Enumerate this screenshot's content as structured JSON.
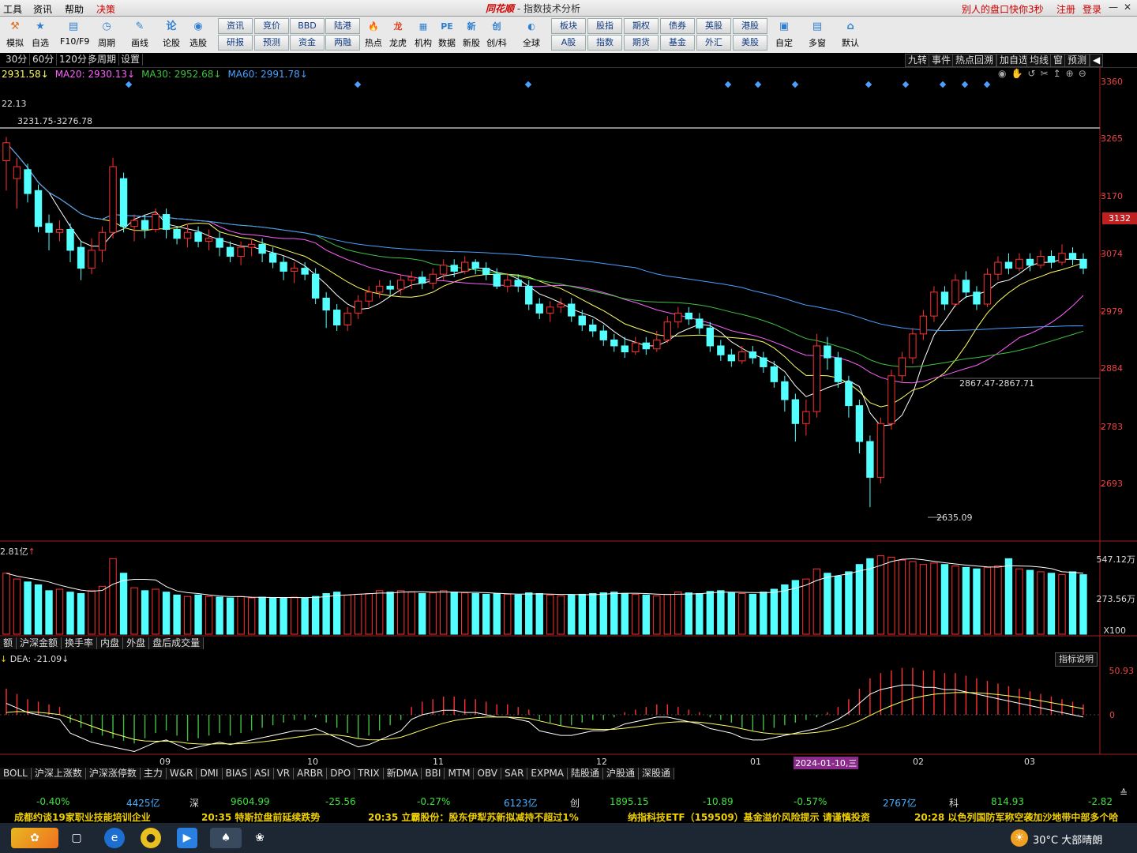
{
  "menubar": {
    "items": [
      "工具",
      "资讯",
      "帮助",
      "决策"
    ],
    "brand": "同花顺",
    "title": "指数技术分析",
    "promo": "别人的盘口快你3秒",
    "register": "注册",
    "login": "登录"
  },
  "toolbar": {
    "big_buttons": [
      {
        "label": "模拟",
        "icon": "simulate-icon"
      },
      {
        "label": "自选",
        "icon": "watchlist-icon"
      },
      {
        "label": "F10/F9",
        "icon": "f10-icon"
      },
      {
        "label": "周期",
        "icon": "period-icon"
      },
      {
        "label": "画线",
        "icon": "draw-line-icon"
      },
      {
        "label": "论股",
        "icon": "discuss-icon"
      },
      {
        "label": "选股",
        "icon": "stock-picker-icon"
      }
    ],
    "small_buttons_top": [
      "资讯",
      "竞价",
      "BBD",
      "陆港"
    ],
    "small_buttons_bottom": [
      "研报",
      "预测",
      "资金",
      "两融"
    ],
    "mid_buttons": [
      {
        "label": "热点",
        "icon": "hot-icon"
      },
      {
        "label": "龙虎",
        "icon": "dragon-tiger-icon"
      },
      {
        "label": "机构",
        "icon": "institution-icon"
      },
      {
        "label": "数据",
        "icon": "data-icon"
      },
      {
        "label": "新股",
        "icon": "ipo-icon"
      },
      {
        "label": "创/科",
        "icon": "chinext-icon"
      },
      {
        "label": "全球",
        "icon": "globe-icon"
      }
    ],
    "small_buttons2_top": [
      "板块",
      "股指",
      "期权",
      "债券",
      "英股",
      "港股"
    ],
    "small_buttons2_bottom": [
      "A股",
      "指数",
      "期货",
      "基金",
      "外汇",
      "美股"
    ],
    "right_buttons": [
      {
        "label": "自定",
        "icon": "custom-icon"
      },
      {
        "label": "多窗",
        "icon": "multi-window-icon"
      },
      {
        "label": "默认",
        "icon": "home-icon"
      }
    ]
  },
  "periods": [
    "30分",
    "60分",
    "120分",
    "多周期",
    "设置"
  ],
  "right_tabs": [
    "九转",
    "事件",
    "热点回溯",
    "加自选",
    "均线",
    "窗",
    "预测"
  ],
  "legend": {
    "close": "2931.58↓",
    "ma20": "MA20: 2930.13↓",
    "ma30": "MA30: 2952.68↓",
    "ma60": "MA60: 2991.78↓"
  },
  "colors": {
    "up": "#ff3030",
    "down": "#54ffff",
    "ma5": "#ffffff",
    "ma10": "#ffff60",
    "ma20": "#ff60ff",
    "ma30": "#40c040",
    "ma60": "#4aa0ff"
  },
  "price_axis": [
    "3360",
    "3265",
    "3170",
    "3074",
    "2979",
    "2884",
    "2783",
    "2693"
  ],
  "current_price_tag": "3132",
  "annotations": {
    "high_left": "22.13",
    "range_top": "3231.75-3276.78",
    "range_mid": "2867.47-2867.71",
    "low": "2635.09"
  },
  "volume": {
    "title": "2.81亿",
    "axis": [
      "547.12万",
      "273.56万",
      "X100"
    ]
  },
  "sub_tabs": [
    "额",
    "沪深金额",
    "换手率",
    "内盘",
    "外盘",
    "盘后成交量"
  ],
  "macd": {
    "title": "DEA: -21.09↓",
    "button": "指标说明",
    "axis": [
      "50.93",
      "0"
    ]
  },
  "x_axis": [
    "09",
    "10",
    "11",
    "12",
    "01",
    "2024-01-10,三",
    "02",
    "03"
  ],
  "indicator_tabs": [
    "BOLL",
    "沪深上涨数",
    "沪深涨停数",
    "主力",
    "W&R",
    "DMI",
    "BIAS",
    "ASI",
    "VR",
    "ARBR",
    "DPO",
    "TRIX",
    "新DMA",
    "BBI",
    "MTM",
    "OBV",
    "SAR",
    "EXPMA",
    "陆股通",
    "沪股通",
    "深股通"
  ],
  "status": {
    "sh_pct": "-0.40%",
    "sh_amt": "4425亿",
    "sz_label": "深",
    "sz_val": "9604.99",
    "sz_chg": "-25.56",
    "sz_pct": "-0.27%",
    "sz_amt": "6123亿",
    "cy_label": "创",
    "cy_val": "1895.15",
    "cy_chg": "-10.89",
    "cy_pct": "-0.57%",
    "cy_amt": "2767亿",
    "kc_label": "科",
    "kc_val": "814.93",
    "kc_chg": "-2.82"
  },
  "ticker": [
    "成都约谈19家职业技能培训企业",
    "20:35 特斯拉盘前延续跌势",
    "20:35 立霸股份：股东伊犁苏新拟减持不超过1%",
    "纳指科技ETF（159509）基金溢价风险提示 请谨慎投资",
    "20:28 以色列国防军称空袭加沙地带中部多个哈"
  ],
  "taskbar": {
    "weather": "30°C 大部晴朗"
  },
  "chart_data": {
    "type": "candlestick",
    "title": "",
    "ylim": [
      2600,
      3380
    ],
    "x_labels": [
      "09",
      "10",
      "11",
      "12",
      "01",
      "2024-01-10",
      "02",
      "03"
    ],
    "candles": [
      [
        3230,
        3260,
        3180,
        3270
      ],
      [
        3200,
        3220,
        3150,
        3235
      ],
      [
        3215,
        3175,
        3160,
        3225
      ],
      [
        3180,
        3120,
        3110,
        3190
      ],
      [
        3125,
        3110,
        3080,
        3140
      ],
      [
        3110,
        3115,
        3095,
        3130
      ],
      [
        3115,
        3080,
        3060,
        3125
      ],
      [
        3085,
        3050,
        3030,
        3095
      ],
      [
        3050,
        3080,
        3040,
        3100
      ],
      [
        3080,
        3110,
        3060,
        3120
      ],
      [
        3110,
        3220,
        3100,
        3235
      ],
      [
        3200,
        3120,
        3110,
        3210
      ],
      [
        3120,
        3130,
        3095,
        3140
      ],
      [
        3130,
        3115,
        3100,
        3140
      ],
      [
        3115,
        3140,
        3110,
        3150
      ],
      [
        3140,
        3115,
        3100,
        3150
      ],
      [
        3115,
        3100,
        3090,
        3120
      ],
      [
        3100,
        3110,
        3085,
        3125
      ],
      [
        3110,
        3095,
        3085,
        3120
      ],
      [
        3095,
        3100,
        3080,
        3115
      ],
      [
        3100,
        3085,
        3070,
        3110
      ],
      [
        3085,
        3070,
        3060,
        3095
      ],
      [
        3070,
        3085,
        3055,
        3095
      ],
      [
        3085,
        3090,
        3070,
        3100
      ],
      [
        3090,
        3075,
        3060,
        3100
      ],
      [
        3075,
        3060,
        3050,
        3085
      ],
      [
        3060,
        3045,
        3030,
        3070
      ],
      [
        3045,
        3050,
        3025,
        3060
      ],
      [
        3050,
        3040,
        3030,
        3060
      ],
      [
        3040,
        3000,
        2990,
        3050
      ],
      [
        3000,
        2980,
        2950,
        3010
      ],
      [
        2980,
        2955,
        2945,
        2990
      ],
      [
        2955,
        2975,
        2945,
        2985
      ],
      [
        2975,
        2995,
        2965,
        3005
      ],
      [
        2995,
        3010,
        2985,
        3020
      ],
      [
        3010,
        3020,
        3000,
        3030
      ],
      [
        3020,
        3015,
        3005,
        3030
      ],
      [
        3015,
        3030,
        3005,
        3040
      ],
      [
        3030,
        3035,
        3015,
        3045
      ],
      [
        3035,
        3025,
        3015,
        3045
      ],
      [
        3025,
        3040,
        3015,
        3050
      ],
      [
        3040,
        3055,
        3030,
        3065
      ],
      [
        3055,
        3045,
        3035,
        3065
      ],
      [
        3045,
        3060,
        3040,
        3070
      ],
      [
        3060,
        3050,
        3040,
        3065
      ],
      [
        3050,
        3040,
        3030,
        3060
      ],
      [
        3040,
        3020,
        3015,
        3050
      ],
      [
        3020,
        3030,
        3010,
        3040
      ],
      [
        3030,
        3020,
        3010,
        3040
      ],
      [
        3020,
        2990,
        2980,
        3030
      ],
      [
        2990,
        2975,
        2965,
        3000
      ],
      [
        2975,
        2985,
        2960,
        2995
      ],
      [
        2985,
        2990,
        2975,
        3000
      ],
      [
        2990,
        2970,
        2960,
        3000
      ],
      [
        2970,
        2955,
        2945,
        2980
      ],
      [
        2955,
        2945,
        2935,
        2965
      ],
      [
        2945,
        2930,
        2920,
        2955
      ],
      [
        2930,
        2920,
        2910,
        2940
      ],
      [
        2920,
        2910,
        2900,
        2935
      ],
      [
        2910,
        2925,
        2905,
        2935
      ],
      [
        2925,
        2915,
        2905,
        2935
      ],
      [
        2915,
        2930,
        2910,
        2945
      ],
      [
        2930,
        2960,
        2925,
        2970
      ],
      [
        2960,
        2975,
        2950,
        2985
      ],
      [
        2975,
        2965,
        2955,
        2985
      ],
      [
        2965,
        2950,
        2940,
        2975
      ],
      [
        2950,
        2920,
        2910,
        2960
      ],
      [
        2920,
        2905,
        2895,
        2930
      ],
      [
        2905,
        2895,
        2885,
        2915
      ],
      [
        2895,
        2910,
        2890,
        2920
      ],
      [
        2910,
        2900,
        2890,
        2920
      ],
      [
        2900,
        2885,
        2875,
        2910
      ],
      [
        2885,
        2860,
        2850,
        2895
      ],
      [
        2860,
        2830,
        2810,
        2870
      ],
      [
        2830,
        2790,
        2760,
        2840
      ],
      [
        2790,
        2810,
        2770,
        2830
      ],
      [
        2810,
        2920,
        2800,
        2940
      ],
      [
        2920,
        2900,
        2880,
        2935
      ],
      [
        2900,
        2860,
        2850,
        2910
      ],
      [
        2860,
        2820,
        2800,
        2870
      ],
      [
        2820,
        2760,
        2740,
        2830
      ],
      [
        2760,
        2700,
        2650,
        2770
      ],
      [
        2700,
        2790,
        2690,
        2800
      ],
      [
        2790,
        2870,
        2780,
        2880
      ],
      [
        2870,
        2900,
        2860,
        2910
      ],
      [
        2900,
        2940,
        2890,
        2950
      ],
      [
        2940,
        2970,
        2930,
        2980
      ],
      [
        2970,
        3010,
        2960,
        3020
      ],
      [
        3010,
        2990,
        2980,
        3020
      ],
      [
        2990,
        3030,
        2985,
        3040
      ],
      [
        3030,
        3010,
        3000,
        3045
      ],
      [
        3010,
        2990,
        2980,
        3020
      ],
      [
        2990,
        3040,
        2985,
        3050
      ],
      [
        3040,
        3060,
        3030,
        3070
      ],
      [
        3060,
        3050,
        3040,
        3075
      ],
      [
        3050,
        3065,
        3045,
        3075
      ],
      [
        3065,
        3055,
        3045,
        3075
      ],
      [
        3055,
        3070,
        3050,
        3080
      ],
      [
        3070,
        3060,
        3050,
        3080
      ],
      [
        3060,
        3075,
        3055,
        3090
      ],
      [
        3075,
        3065,
        3055,
        3085
      ],
      [
        3065,
        3050,
        3040,
        3075
      ]
    ],
    "volume": [
      420,
      380,
      360,
      340,
      300,
      310,
      290,
      280,
      300,
      330,
      520,
      420,
      320,
      300,
      310,
      290,
      270,
      260,
      270,
      260,
      255,
      250,
      260,
      250,
      255,
      250,
      250,
      255,
      250,
      260,
      280,
      290,
      270,
      275,
      280,
      300,
      290,
      300,
      290,
      280,
      285,
      300,
      290,
      285,
      280,
      275,
      280,
      275,
      270,
      285,
      280,
      270,
      265,
      270,
      275,
      280,
      285,
      290,
      280,
      275,
      270,
      265,
      275,
      290,
      285,
      280,
      295,
      300,
      285,
      280,
      275,
      290,
      310,
      340,
      370,
      380,
      450,
      420,
      400,
      430,
      480,
      520,
      540,
      530,
      510,
      500,
      480,
      490,
      480,
      470,
      460,
      450,
      460,
      470,
      520,
      450,
      440,
      430,
      420,
      410,
      430,
      410
    ],
    "macd_hist": [
      10,
      8,
      6,
      5,
      4,
      3,
      -3,
      -5,
      -7,
      -8,
      -9,
      -10,
      -11,
      -9,
      -7,
      -6,
      -8,
      -10,
      -9,
      -8,
      -7,
      -8,
      -7,
      -6,
      -5,
      -4,
      -3,
      -2,
      -2,
      -1,
      -3,
      -5,
      -7,
      -9,
      -8,
      -6,
      -4,
      -2,
      3,
      5,
      6,
      7,
      7,
      6,
      6,
      5,
      4,
      4,
      3,
      2,
      -2,
      -3,
      -4,
      -4,
      -3,
      -2,
      -2,
      -1,
      1,
      2,
      3,
      4,
      4,
      3,
      2,
      1,
      -1,
      -2,
      -3,
      -5,
      -6,
      -6,
      -5,
      -4,
      -3,
      -2,
      -1,
      1,
      3,
      6,
      10,
      14,
      16,
      17,
      18,
      18,
      17,
      17,
      16,
      16,
      15,
      14,
      13,
      12,
      11,
      10,
      9,
      8,
      7,
      6,
      5,
      4
    ]
  }
}
